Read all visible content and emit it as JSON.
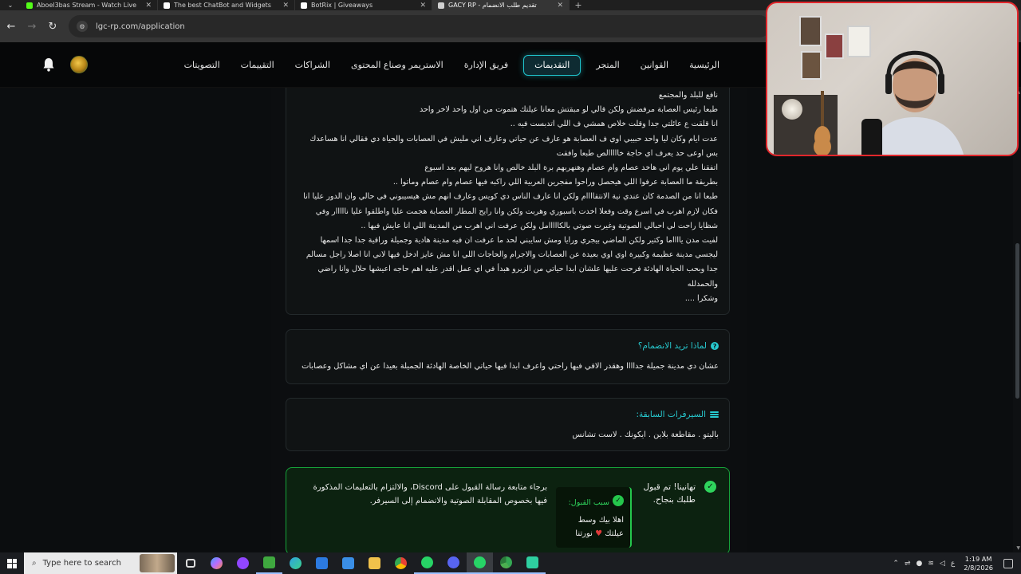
{
  "browser": {
    "tabs": [
      {
        "title": "Aboel3bas Stream - Watch Live",
        "favicon": "kick-icon",
        "color": "#53fc18",
        "active": false
      },
      {
        "title": "The best ChatBot and Widgets",
        "favicon": "botrix-icon",
        "color": "#ffffff",
        "active": false
      },
      {
        "title": "BotRix | Giveaways",
        "favicon": "botrix-icon",
        "color": "#ffffff",
        "active": false
      },
      {
        "title": "GACY RP - تقديم طلب الانضمام",
        "favicon": "legacy-icon",
        "color": "#d0d0d0",
        "active": true
      }
    ],
    "url": "lgc-rp.com/application"
  },
  "site": {
    "nav": [
      {
        "label": "الرئيسية",
        "active": false
      },
      {
        "label": "القوانين",
        "active": false
      },
      {
        "label": "المتجر",
        "active": false
      },
      {
        "label": "التقديمات",
        "active": true
      },
      {
        "label": "فريق الإدارة",
        "active": false
      },
      {
        "label": "الاستريمر وصناع المحتوى",
        "active": false
      },
      {
        "label": "الشراكات",
        "active": false
      },
      {
        "label": "التقييمات",
        "active": false
      },
      {
        "label": "التصويتات",
        "active": false
      }
    ]
  },
  "story": {
    "lines": [
      "نافع للبلد والمجتمع",
      "طبعا رئيس العصابة مرفضش ولكن قالي لو مبقتش معانا عيلتك هتموت من اول واحد لاخر واحد",
      "انا قلقت ع عائلتي جدا وقلت خلاص همشي ف اللي اتدبست فيه ..",
      "عدت ايام وكان ليا واحد حبيبي اوي ف العصابة هو عارف عن حياتي وعارف اني مليش في العصابات والحياة دي فقالي انا هساعدك",
      "بس اوعى حد يعرف اي حاجة خااااالص طبعا وافقت",
      "اتفقنا علي يوم اني هاخد عصام وام عصام وهنهربهم برة البلد خالص وانا هروح ليهم بعد اسبوع",
      "بطريقة ما العصابة عرفوا اللي هيحصل وراحوا مفجرين العربية اللي راكبه فيها عصام وام عصام وماتوا ..",
      "طبعا انا من الصدمة كان عندي نية الانتقاااام ولكن انا عارف الناس دي كويس وعارف انهم مش هيسيبوني في حالي وان الدور عليا انا",
      "فكان لازم اهرب في اسرع وقت وفعلا اخدت باسبوري وهربت ولكن وانا رايح المطار العصابة هجمت عليا واطلقوا عليا نااااار وفي",
      "شظايا راحت لي احبالي الصوتية وغيرت صوتي بالكااااامل ولكن عرفت اني اهرب من المدينة اللي انا عايش فيها ..",
      "لفيت مدن يااااما وكتير ولكن الماضي بيجري ورايا ومش سايبني لحد ما عرفت ان فيه مدينة هادية وجميلة وراقية جدا جدا اسمها",
      "ليجسي مدينة عظيمة وكبيرة اوي اوي بعيدة عن العصابات والاجرام والحاجات اللي انا مش عايز ادخل فيها لاني انا اصلا راجل مسالم",
      "جدا وبحب الحياة الهادئة فرحت عليها علشان ابدا حياتي من الزيرو هبدأ في اي عمل اقدر عليه اهم حاجه اعيشها حلال وانا راضي",
      "والحمدلله",
      "وشكرا ...."
    ]
  },
  "why_join": {
    "title": "لماذا تريد الانضمام؟",
    "answer": "عشان دي مدينة جميلة جداااا وهقدر الاقي فيها راحتي واعرف ابدا فيها حياتي الخاصة الهادئة الجميلة بعيدا عن اي مشاكل وعصابات"
  },
  "previous_servers": {
    "title": "السيرفرات السابقة:",
    "answer": "باليتو . مقاطعة بلاين . ايكونك . لاست تشانس"
  },
  "acceptance": {
    "title": "تهانينا! تم قبول طلبك بنجاح.",
    "reason_label": "سبب القبول:",
    "reason_text": "اهلا بيك وسط عيلتك",
    "reason_suffix": "نورتنا",
    "message": "برجاء متابعة رسالة القبول على Discord، والالتزام بالتعليمات المذكورة فيها بخصوص المقابلة الصوتية والانضمام إلى السيرفر."
  },
  "taskbar": {
    "search_placeholder": "Type here to search",
    "apps": [
      {
        "name": "task-view-icon",
        "color": "#dddddd"
      },
      {
        "name": "copilot-icon",
        "color": "#7b8cff"
      },
      {
        "name": "twitch-app-icon",
        "color": "#9146ff"
      },
      {
        "name": "xbox-icon",
        "color": "#3fa83f"
      },
      {
        "name": "edge-icon",
        "color": "#2fa3e0"
      },
      {
        "name": "mail-icon",
        "color": "#2c7ae0"
      },
      {
        "name": "store-icon",
        "color": "#3a8ee6"
      },
      {
        "name": "file-explorer-icon",
        "color": "#f1c14b"
      },
      {
        "name": "chrome-icon",
        "color": "#e9a93a"
      },
      {
        "name": "whatsapp-icon",
        "color": "#27d366"
      },
      {
        "name": "discord-icon",
        "color": "#5865f2"
      },
      {
        "name": "whatsapp-icon",
        "color": "#27d366"
      },
      {
        "name": "chrome-icon",
        "color": "#4caf50"
      },
      {
        "name": "obs-icon",
        "color": "#2ecfa0"
      }
    ],
    "time": "1:19 AM",
    "date": "2/8/2026",
    "lang": "ع"
  },
  "colors": {
    "accent": "#27c9cf",
    "success": "#2fd45c",
    "webcam_border": "#e2272c"
  }
}
